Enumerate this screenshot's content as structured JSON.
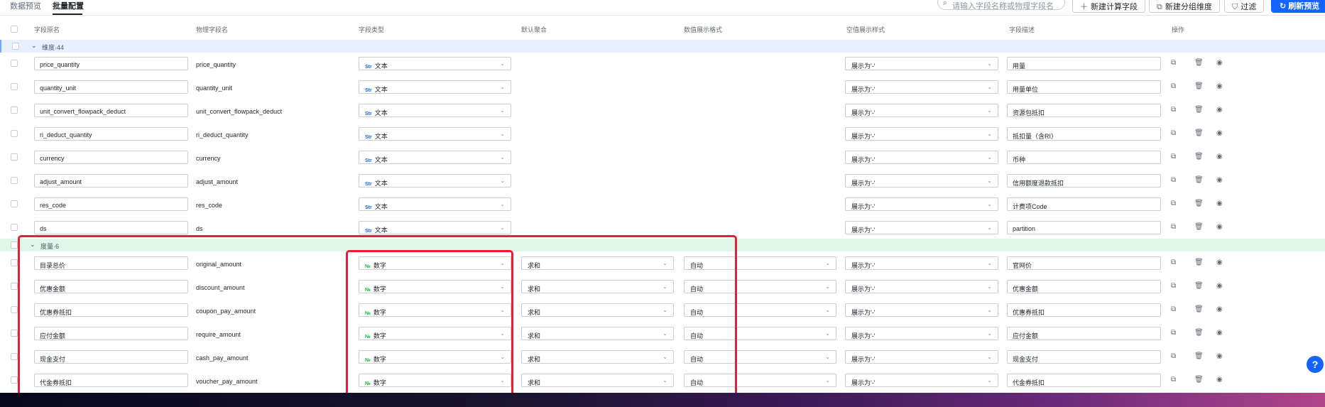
{
  "tabs": [
    {
      "label": "数据预览",
      "active": false
    },
    {
      "label": "批量配置",
      "active": true
    }
  ],
  "toolbar": {
    "search_placeholder": "请输入字段名称或物理字段名",
    "new_calc_label": "新建计算字段",
    "new_group_label": "新建分组维度",
    "filter_label": "过滤",
    "refresh_label": "刷新预览"
  },
  "headers": [
    "字段原名",
    "物理字段名",
    "字段类型",
    "默认聚合",
    "数值展示格式",
    "空值展示样式",
    "字段描述",
    "操作"
  ],
  "groups": {
    "dimension": "维度·44",
    "measure": "度量·6"
  },
  "type_labels": {
    "text": "文本",
    "number": "数字"
  },
  "type_icons": {
    "text": "Str",
    "number": "№"
  },
  "dimension_rows": [
    {
      "name": "price_quantity",
      "physical": "price_quantity",
      "type": "文本",
      "null_style": "展示为'-'",
      "desc": "用量"
    },
    {
      "name": "quantity_unit",
      "physical": "quantity_unit",
      "type": "文本",
      "null_style": "展示为'-'",
      "desc": "用量单位"
    },
    {
      "name": "unit_convert_flowpack_deduct",
      "physical": "unit_convert_flowpack_deduct",
      "type": "文本",
      "null_style": "展示为'-'",
      "desc": "资源包抵扣"
    },
    {
      "name": "ri_deduct_quantity",
      "physical": "ri_deduct_quantity",
      "type": "文本",
      "null_style": "展示为'-'",
      "desc": "抵扣量（含RI）"
    },
    {
      "name": "currency",
      "physical": "currency",
      "type": "文本",
      "null_style": "展示为'-'",
      "desc": "币种"
    },
    {
      "name": "adjust_amount",
      "physical": "adjust_amount",
      "type": "文本",
      "null_style": "展示为'-'",
      "desc": "信用额度退款抵扣"
    },
    {
      "name": "res_code",
      "physical": "res_code",
      "type": "文本",
      "null_style": "展示为'-'",
      "desc": "计费项Code"
    },
    {
      "name": "ds",
      "physical": "ds",
      "type": "文本",
      "null_style": "展示为'-'",
      "desc": "partition"
    }
  ],
  "measure_rows": [
    {
      "name": "目录总价",
      "physical": "original_amount",
      "type": "数字",
      "agg": "求和",
      "format": "自动",
      "null_style": "展示为'-'",
      "desc": "官网价"
    },
    {
      "name": "优惠金额",
      "physical": "discount_amount",
      "type": "数字",
      "agg": "求和",
      "format": "自动",
      "null_style": "展示为'-'",
      "desc": "优惠金额"
    },
    {
      "name": "优惠券抵扣",
      "physical": "coupon_pay_amount",
      "type": "数字",
      "agg": "求和",
      "format": "自动",
      "null_style": "展示为'-'",
      "desc": "优惠券抵扣"
    },
    {
      "name": "应付金额",
      "physical": "require_amount",
      "type": "数字",
      "agg": "求和",
      "format": "自动",
      "null_style": "展示为'-'",
      "desc": "应付金额"
    },
    {
      "name": "现金支付",
      "physical": "cash_pay_amount",
      "type": "数字",
      "agg": "求和",
      "format": "自动",
      "null_style": "展示为'-'",
      "desc": "现金支付"
    },
    {
      "name": "代金券抵扣",
      "physical": "voucher_pay_amount",
      "type": "数字",
      "agg": "求和",
      "format": "自动",
      "null_style": "展示为'-'",
      "desc": "代金券抵扣"
    }
  ],
  "colors": {
    "primary": "#1664ff",
    "highlight": "#e51f36",
    "dimension_bg": "#e8f0ff",
    "measure_bg": "#dff7e8"
  }
}
